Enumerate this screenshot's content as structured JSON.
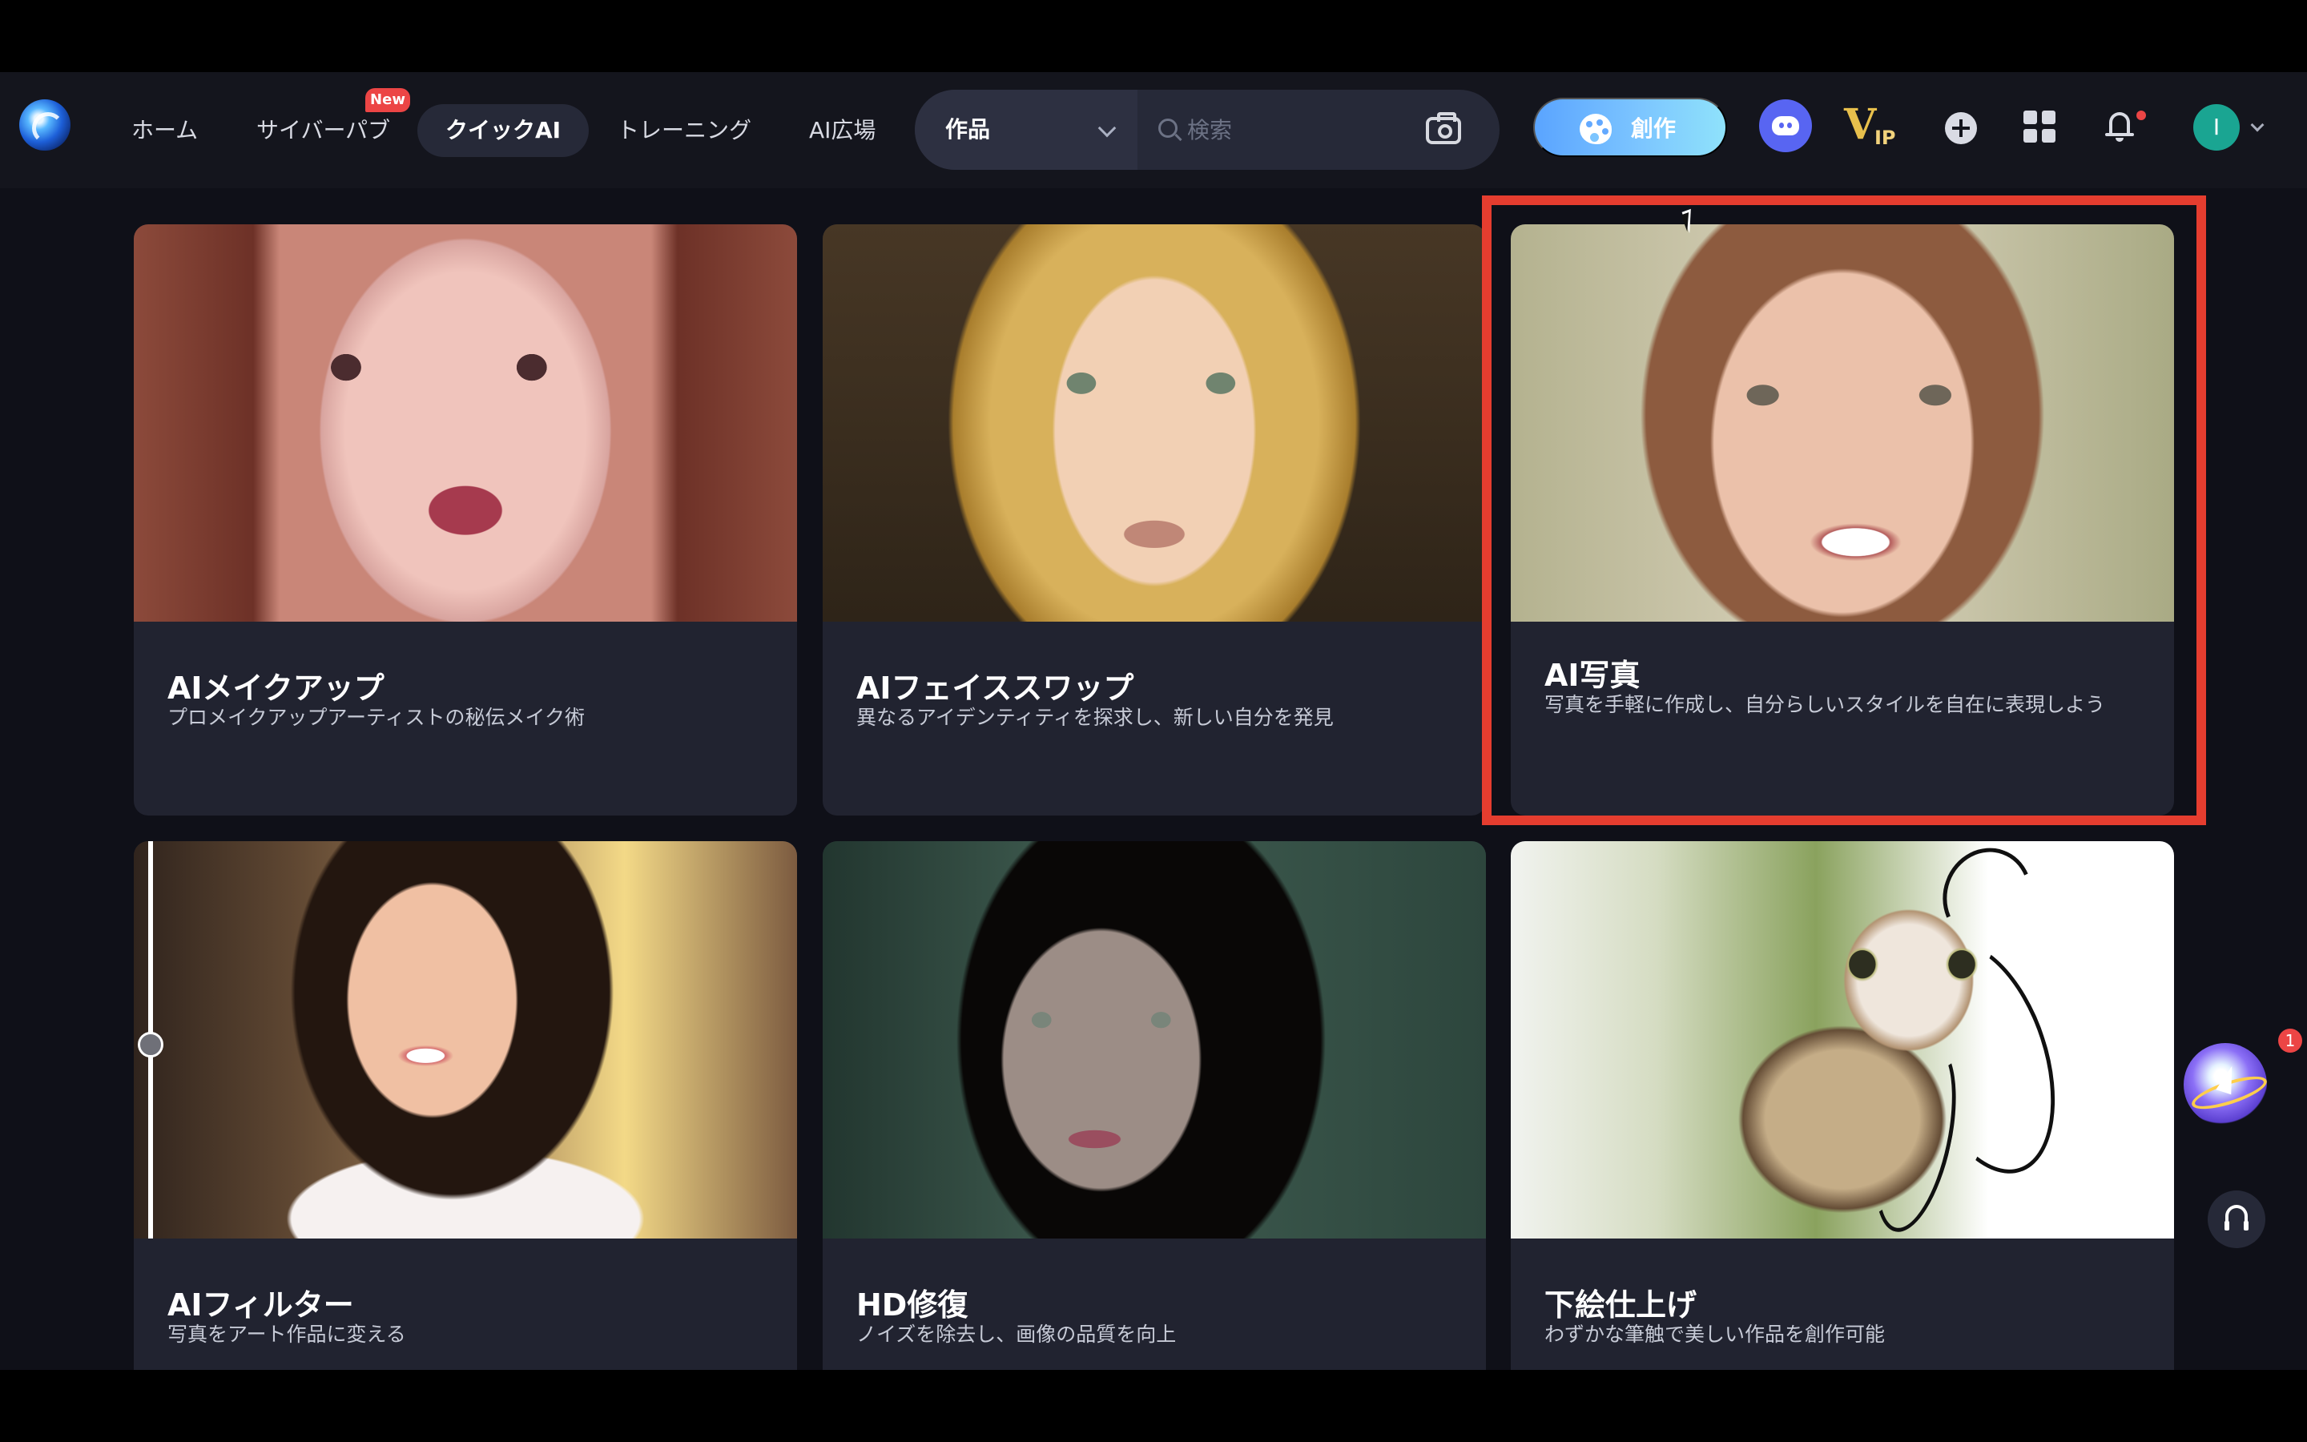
{
  "nav": {
    "items": [
      {
        "label": "ホーム"
      },
      {
        "label": "サイバーパブ",
        "badge": "New"
      },
      {
        "label": "クイックAI",
        "active": true
      },
      {
        "label": "トレーニング"
      },
      {
        "label": "AI広場"
      }
    ],
    "search": {
      "category": "作品",
      "placeholder": "検索"
    },
    "create_label": "創作",
    "vip_v": "V",
    "vip_ip": "IP",
    "avatar_initial": "I",
    "icons": [
      "logo",
      "discord-icon",
      "vip-icon",
      "plus-icon",
      "apps-grid-icon",
      "bell-icon",
      "camera-icon"
    ]
  },
  "cards": [
    {
      "title": "AIメイクアップ",
      "description": "プロメイクアップアーティストの秘伝メイク術"
    },
    {
      "title": "AIフェイススワップ",
      "description": "異なるアイデンティティを探求し、新しい自分を発見"
    },
    {
      "title": "AI写真",
      "description": "写真を手軽に作成し、自分らしいスタイルを自在に表現しよう",
      "highlighted": true
    },
    {
      "title": "AIフィルター",
      "description": "写真をアート作品に変える"
    },
    {
      "title": "HD修復",
      "description": "ノイズを除去し、画像の品質を向上"
    },
    {
      "title": "下絵仕上げ",
      "description": "わずかな筆触で美しい作品を創作可能"
    }
  ],
  "floating": {
    "assistant_badge": "1"
  },
  "colors": {
    "highlight": "#e53d2f",
    "accent_gradient_start": "#5aa4ff",
    "accent_gradient_end": "#8fe2fb",
    "active_nav": "#262938"
  }
}
